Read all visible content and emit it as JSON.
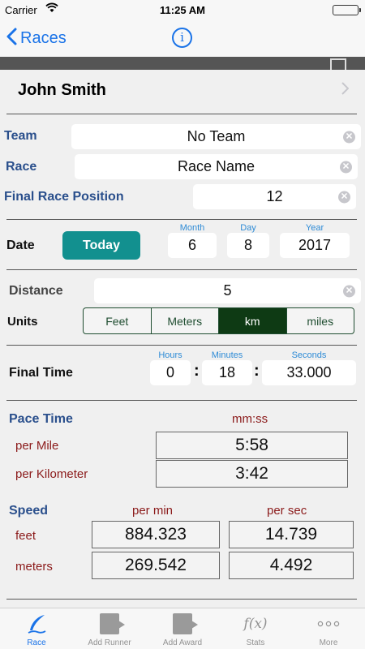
{
  "status_bar": {
    "carrier": "Carrier",
    "time": "11:25 AM"
  },
  "nav": {
    "back_label": "Races",
    "info_symbol": "i"
  },
  "runner": {
    "name": "John Smith"
  },
  "fields": {
    "team_label": "Team",
    "team_value": "No Team",
    "race_label": "Race",
    "race_value": "Race Name",
    "position_label": "Final Race Position",
    "position_value": "12"
  },
  "date": {
    "label": "Date",
    "today_button": "Today",
    "month_label": "Month",
    "month": "6",
    "day_label": "Day",
    "day": "8",
    "year_label": "Year",
    "year": "2017"
  },
  "distance": {
    "label": "Distance",
    "value": "5",
    "units_label": "Units",
    "units": [
      "Feet",
      "Meters",
      "km",
      "miles"
    ],
    "selected_unit": "km"
  },
  "final_time": {
    "label": "Final Time",
    "hours_label": "Hours",
    "hours": "0",
    "minutes_label": "Minutes",
    "minutes": "18",
    "seconds_label": "Seconds",
    "seconds": "33.000"
  },
  "pace": {
    "label": "Pace Time",
    "format_label": "mm:ss",
    "per_mile_label": "per Mile",
    "per_mile": "5:58",
    "per_km_label": "per Kilometer",
    "per_km": "3:42"
  },
  "speed": {
    "label": "Speed",
    "per_min_label": "per min",
    "per_sec_label": "per sec",
    "feet_label": "feet",
    "feet_per_min": "884.323",
    "feet_per_sec": "14.739",
    "meters_label": "meters",
    "meters_per_min": "269.542",
    "meters_per_sec": "4.492"
  },
  "tabs": [
    {
      "label": "Race",
      "icon": "quill-icon",
      "active": true
    },
    {
      "label": "Add Runner",
      "icon": "add-runner-icon",
      "active": false
    },
    {
      "label": "Add Award",
      "icon": "add-award-icon",
      "active": false
    },
    {
      "label": "Stats",
      "icon": "function-icon",
      "active": false
    },
    {
      "label": "More",
      "icon": "more-icon",
      "active": false
    }
  ],
  "colors": {
    "accent": "#1a73e8",
    "today_button": "#12908f",
    "selected_segment": "#0e3a14",
    "label_blue": "#2a4f8c",
    "label_red": "#8b1a1a"
  }
}
